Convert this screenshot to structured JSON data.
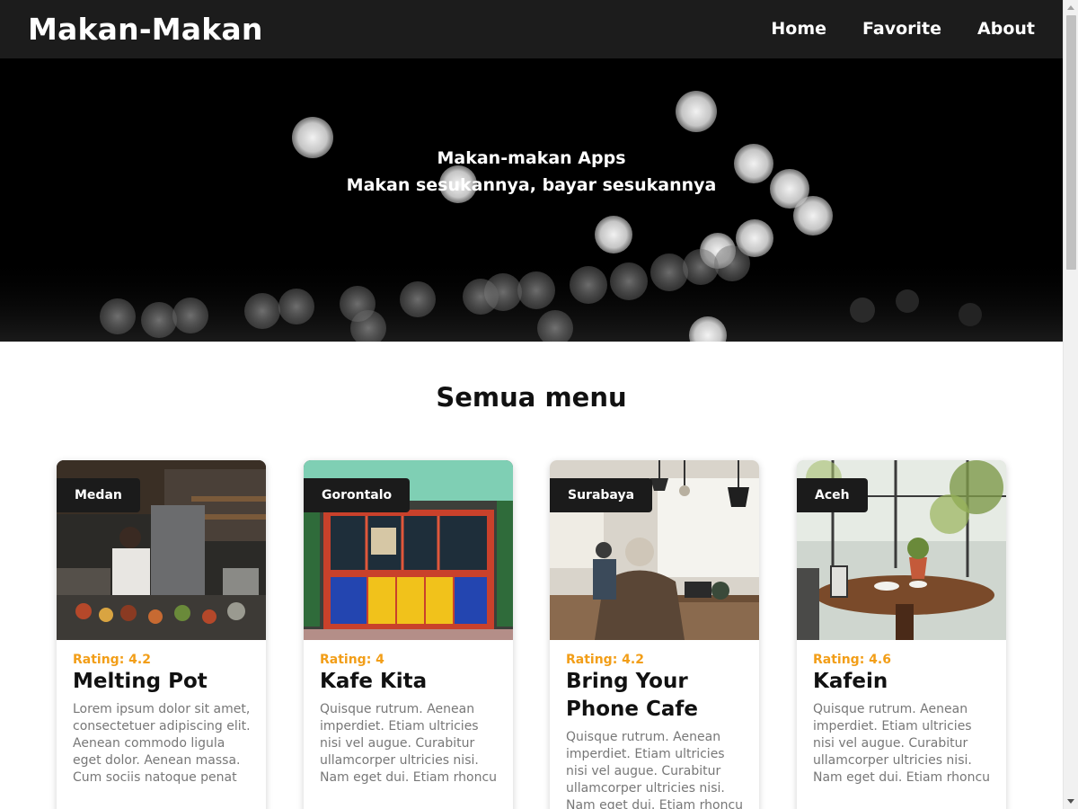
{
  "header": {
    "brand": "Makan-Makan",
    "nav": [
      "Home",
      "Favorite",
      "About"
    ]
  },
  "hero": {
    "line1": "Makan-makan Apps",
    "line2": "Makan sesukannya, bayar sesukannya"
  },
  "section_title": "Semua menu",
  "restaurants": [
    {
      "city": "Medan",
      "rating_text": "Rating: 4.2",
      "name": "Melting Pot",
      "description": "Lorem ipsum dolor sit amet, consectetuer adipiscing elit. Aenean commodo ligula eget dolor. Aenean massa. Cum sociis natoque penat"
    },
    {
      "city": "Gorontalo",
      "rating_text": "Rating: 4",
      "name": "Kafe Kita",
      "description": "Quisque rutrum. Aenean imperdiet. Etiam ultricies nisi vel augue. Curabitur ullamcorper ultricies nisi. Nam eget dui. Etiam rhoncu"
    },
    {
      "city": "Surabaya",
      "rating_text": "Rating: 4.2",
      "name": "Bring Your Phone Cafe",
      "description": "Quisque rutrum. Aenean imperdiet. Etiam ultricies nisi vel augue. Curabitur ullamcorper ultricies nisi. Nam eget dui. Etiam rhoncu"
    },
    {
      "city": "Aceh",
      "rating_text": "Rating: 4.6",
      "name": "Kafein",
      "description": "Quisque rutrum. Aenean imperdiet. Etiam ultricies nisi vel augue. Curabitur ullamcorper ultricies nisi. Nam eget dui. Etiam rhoncu"
    }
  ],
  "colors": {
    "header_bg": "#1c1c1c",
    "rating": "#f29e18",
    "badge_bg": "#1b1b1b",
    "description": "#777777"
  }
}
